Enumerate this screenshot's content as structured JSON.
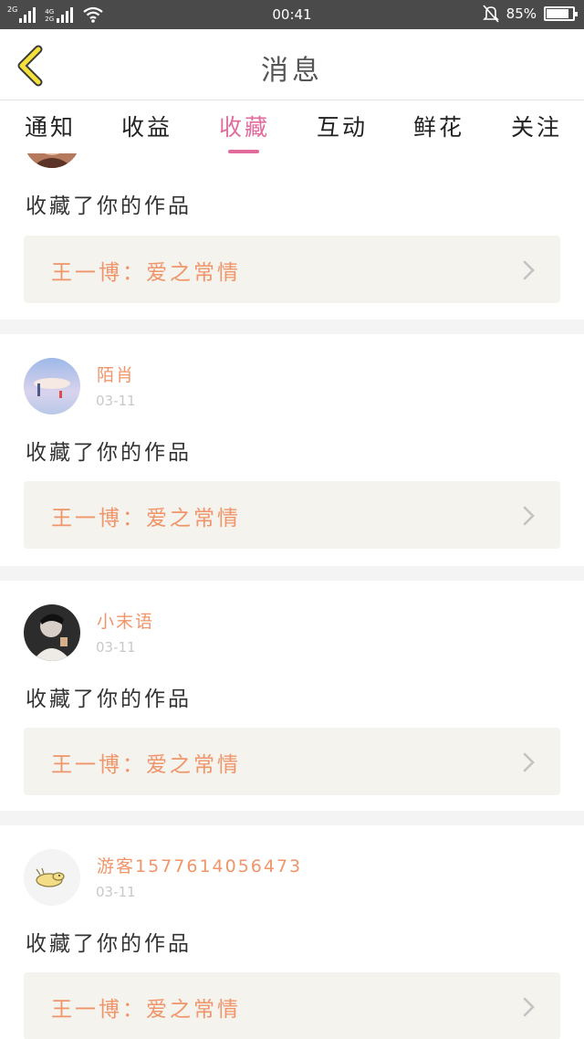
{
  "status_bar": {
    "sim1": "2G",
    "sim2_top": "4G",
    "sim2_bottom": "2G",
    "time": "00:41",
    "battery": "85%",
    "battery_level": 0.85
  },
  "header": {
    "title": "消息"
  },
  "tabs": [
    {
      "label": "通知"
    },
    {
      "label": "收益"
    },
    {
      "label": "收藏"
    },
    {
      "label": "互动"
    },
    {
      "label": "鲜花"
    },
    {
      "label": "关注"
    }
  ],
  "active_tab": "收藏",
  "items": [
    {
      "action": "收藏了你的作品",
      "work": "王一博：爱之常情"
    },
    {
      "user": "陌肖",
      "date": "03-11",
      "action": "收藏了你的作品",
      "work": "王一博：爱之常情"
    },
    {
      "user": "小末语",
      "date": "03-11",
      "action": "收藏了你的作品",
      "work": "王一博：爱之常情"
    },
    {
      "user": "游客1577614056473",
      "date": "03-11",
      "action": "收藏了你的作品",
      "work": "王一博：爱之常情"
    }
  ],
  "colors": {
    "accent_pink": "#e26b9c",
    "username_orange": "#f0956a",
    "work_bg": "#f4f3ee",
    "status_bar": "#4a4a4a"
  },
  "icons": {
    "back": "chevron-left-icon",
    "row_arrow": "chevron-right-icon",
    "wifi": "wifi-icon",
    "mute": "bell-muted-icon",
    "battery": "battery-icon"
  }
}
